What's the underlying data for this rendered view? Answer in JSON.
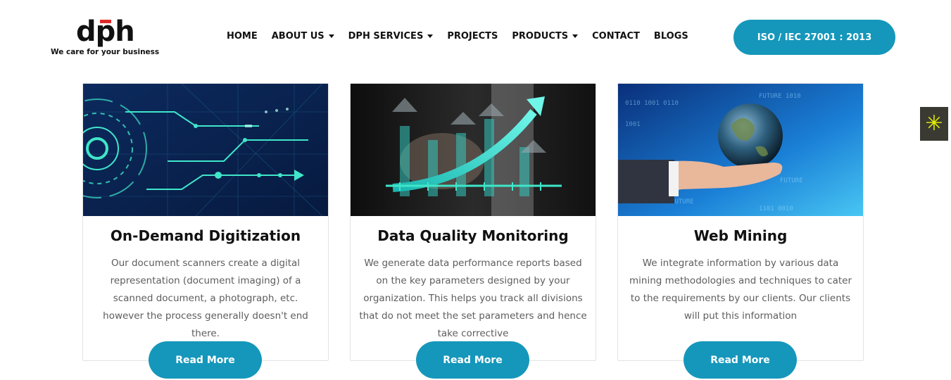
{
  "brand": {
    "logo_text_d": "d",
    "logo_text_p": "p",
    "logo_text_h": "h",
    "tagline": "We care for your business",
    "accent_color": "#1597bb",
    "logo_red": "#e02a2a"
  },
  "nav": {
    "items": [
      {
        "label": "HOME",
        "dropdown": false
      },
      {
        "label": "ABOUT US",
        "dropdown": true
      },
      {
        "label": "DPH SERVICES",
        "dropdown": true
      },
      {
        "label": "PROJECTS",
        "dropdown": false
      },
      {
        "label": "PRODUCTS",
        "dropdown": true
      },
      {
        "label": "CONTACT",
        "dropdown": false
      },
      {
        "label": "BLOGS",
        "dropdown": false
      }
    ],
    "iso_button": "ISO / IEC 27001 : 2013"
  },
  "side_widget": {
    "icon": "asterisk-sunburst-icon",
    "glyph": "✳"
  },
  "cards": [
    {
      "title": "On-Demand Digitization",
      "text": "Our document scanners create a digital representation (document imaging) of a scanned document, a photograph, etc. however the process generally doesn't end there.",
      "button": "Read More",
      "image": "circuit-technology-image"
    },
    {
      "title": "Data Quality Monitoring",
      "text": "We generate data performance reports based on the key parameters designed by your organization. This helps you track all divisions that do not meet the set parameters and hence take corrective",
      "button": "Read More",
      "image": "growth-chart-image"
    },
    {
      "title": "Web Mining",
      "text": "We integrate information by various data mining methodologies and techniques to cater to the requirements by our clients. Our clients will put this information",
      "button": "Read More",
      "image": "globe-in-hand-image"
    }
  ]
}
